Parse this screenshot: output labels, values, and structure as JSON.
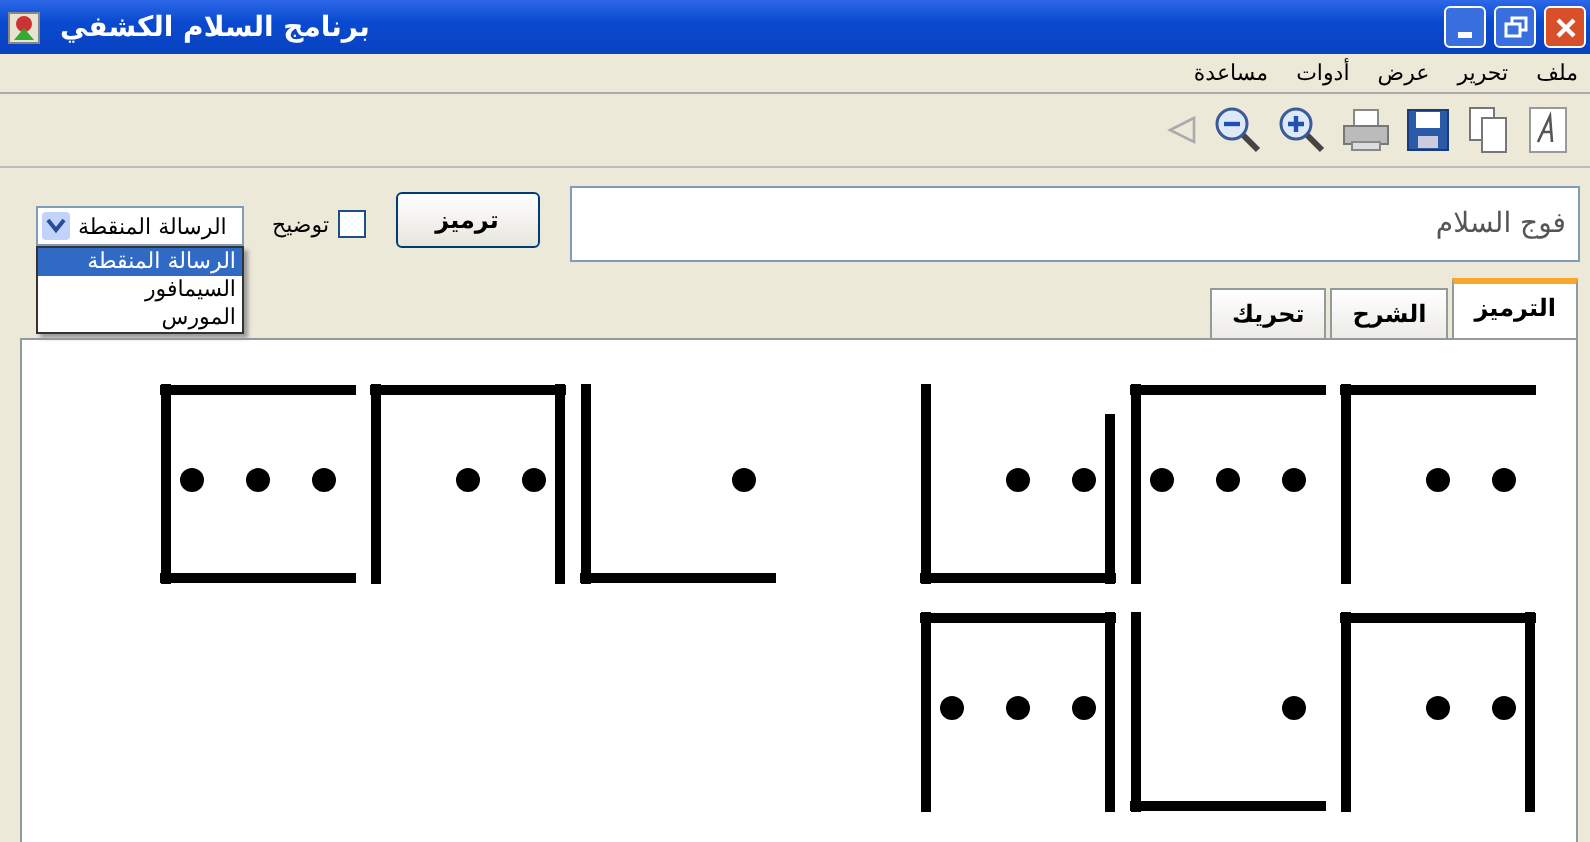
{
  "window": {
    "title": "برنامج السلام الكشفي"
  },
  "menu": [
    "ملف",
    "تحرير",
    "عرض",
    "أدوات",
    "مساعدة"
  ],
  "toolbar": [
    {
      "kind": "font",
      "disabled": false
    },
    {
      "kind": "copy",
      "disabled": false
    },
    {
      "kind": "save",
      "disabled": false
    },
    {
      "kind": "print",
      "disabled": false
    },
    {
      "kind": "zoom-in",
      "disabled": false
    },
    {
      "kind": "zoom-out",
      "disabled": false
    },
    {
      "kind": "back",
      "disabled": true
    }
  ],
  "message": {
    "value": "فوج السلام"
  },
  "encode_button": "ترميز",
  "explain_checkbox": {
    "label": "توضيح",
    "checked": false
  },
  "cipher_select": {
    "value": "الرسالة المنقطة",
    "options": [
      {
        "label": "الرسالة المنقطة",
        "selected": true
      },
      {
        "label": "السيمافور",
        "selected": false
      },
      {
        "label": "المورس",
        "selected": false
      }
    ]
  },
  "tabs": [
    {
      "label": "الترميز",
      "selected": true
    },
    {
      "label": "الشرح",
      "selected": false
    },
    {
      "label": "تحريك",
      "selected": false
    }
  ],
  "glyphs": [
    {
      "kind": "corner-top-left-two"
    },
    {
      "kind": "corner-top-left-three"
    },
    {
      "kind": "open-top-two"
    },
    {
      "kind": "space"
    },
    {
      "kind": "corner-bottom-left-one"
    },
    {
      "kind": "open-bottom-two"
    },
    {
      "kind": "open-right-three"
    },
    {
      "kind": "open-bottom-two"
    },
    {
      "kind": "corner-bottom-left-one"
    },
    {
      "kind": "open-bottom-three"
    }
  ]
}
